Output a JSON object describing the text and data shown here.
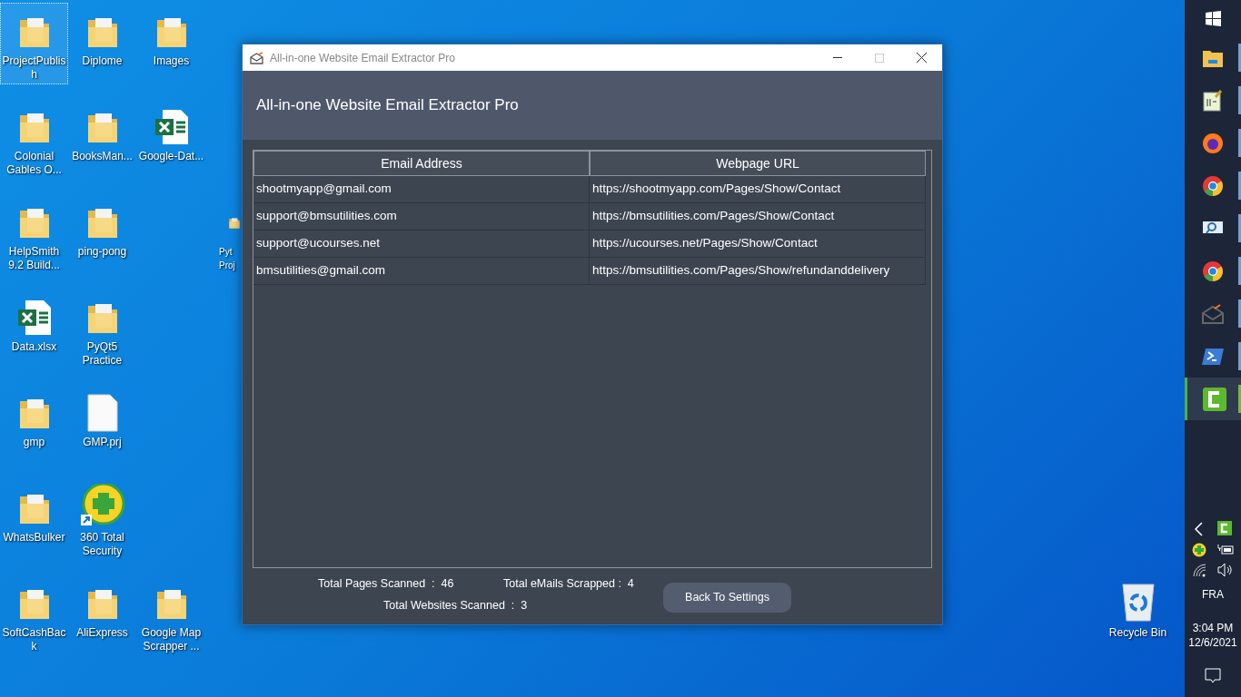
{
  "desktop": {
    "icons": [
      {
        "label": "ProjectPublish",
        "kind": "folder",
        "selected": true
      },
      {
        "label": "Diplome",
        "kind": "folder",
        "selected": false
      },
      {
        "label": "Images",
        "kind": "folder",
        "selected": false
      },
      {
        "label": "Colonial Gables O...",
        "kind": "folder",
        "selected": false
      },
      {
        "label": "BooksMan...",
        "kind": "folder",
        "selected": false
      },
      {
        "label": "Google-Dat...",
        "kind": "excel",
        "selected": false
      },
      {
        "label": "HelpSmith 9.2 Build...",
        "kind": "folder",
        "selected": false
      },
      {
        "label": "ping-pong",
        "kind": "folder",
        "selected": false
      },
      {
        "label": "Pyt Proj",
        "kind": "folder",
        "selected": false
      },
      {
        "label": "Data.xlsx",
        "kind": "excel",
        "selected": false
      },
      {
        "label": "PyQt5 Practice",
        "kind": "folder",
        "selected": false
      },
      {
        "label": "gmp",
        "kind": "folder",
        "selected": false
      },
      {
        "label": "GMP.prj",
        "kind": "file",
        "selected": false
      },
      {
        "label": "WhatsBulker",
        "kind": "folder",
        "selected": false
      },
      {
        "label": "360 Total Security",
        "kind": "app",
        "selected": false
      },
      {
        "label": "SoftCashBack",
        "kind": "folder",
        "selected": false
      },
      {
        "label": "AliExpress",
        "kind": "folder",
        "selected": false
      },
      {
        "label": "Google Map Scrapper ...",
        "kind": "folder",
        "selected": false
      },
      {
        "label": "Recycle Bin",
        "kind": "recycle",
        "selected": false
      }
    ]
  },
  "window": {
    "title": "All-in-one Website Email Extractor Pro",
    "header": "All-in-one Website Email Extractor Pro",
    "table": {
      "columns": [
        "Email Address",
        "Webpage URL"
      ],
      "rows": [
        [
          "shootmyapp@gmail.com",
          "https://shootmyapp.com/Pages/Show/Contact"
        ],
        [
          "support@bmsutilities.com",
          "https://bmsutilities.com/Pages/Show/Contact"
        ],
        [
          "support@ucourses.net",
          "https://ucourses.net/Pages/Show/Contact"
        ],
        [
          "bmsutilities@gmail.com",
          "https://bmsutilities.com/Pages/Show/refundanddelivery"
        ]
      ]
    },
    "stats": [
      {
        "label": "Total Pages Scanned  :",
        "value": "46"
      },
      {
        "label": "Total eMails Scrapped :",
        "value": "4"
      },
      {
        "label": "Total Websites Scanned  :",
        "value": "3"
      }
    ],
    "button": "Back To Settings"
  },
  "taskbar": {
    "apps": [
      {
        "kind": "explorer",
        "active": false
      },
      {
        "kind": "notepad",
        "active": false
      },
      {
        "kind": "firefox",
        "active": false
      },
      {
        "kind": "chrome",
        "active": false
      },
      {
        "kind": "viewer",
        "active": false
      },
      {
        "kind": "chrome",
        "active": false
      },
      {
        "kind": "mail",
        "active": false
      },
      {
        "kind": "powershell",
        "active": false
      },
      {
        "kind": "camtasia",
        "active": true
      }
    ],
    "language": "FRA",
    "time": "3:04 PM",
    "date": "12/6/2021"
  }
}
